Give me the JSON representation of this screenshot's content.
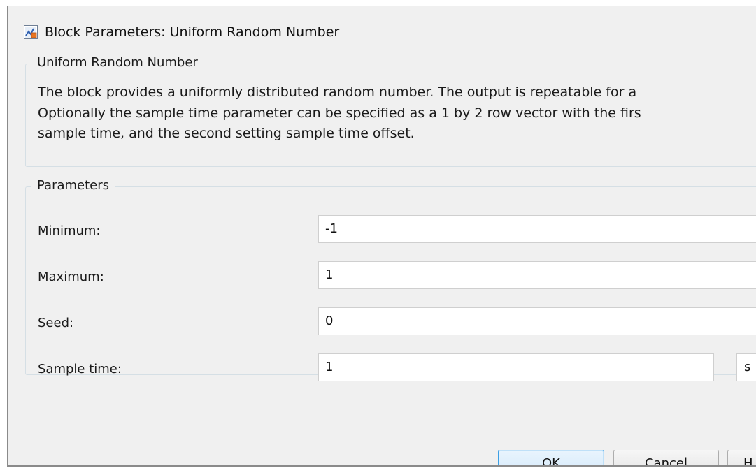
{
  "window": {
    "title": "Block Parameters: Uniform Random Number",
    "icon": "simulink-block-icon"
  },
  "description_group": {
    "legend": "Uniform Random Number",
    "lines": [
      "The block provides a uniformly distributed random number. The output is repeatable for a",
      "Optionally the sample time parameter can be specified as a 1 by 2 row vector with the firs",
      "sample time, and the second setting sample time offset."
    ]
  },
  "parameters_group": {
    "legend": "Parameters",
    "minimum": {
      "label": "Minimum:",
      "value": "-1"
    },
    "maximum": {
      "label": "Maximum:",
      "value": "1"
    },
    "seed": {
      "label": "Seed:",
      "value": "0"
    },
    "sample_time": {
      "label": "Sample time:",
      "value": "1",
      "unit": "s"
    }
  },
  "buttons": {
    "ok": "OK",
    "cancel": "Cancel",
    "help": "H"
  },
  "colors": {
    "dialog_bg": "#f0f0f0",
    "focus_button_border": "#3c9fe4",
    "group_border": "#d5dfe5"
  }
}
